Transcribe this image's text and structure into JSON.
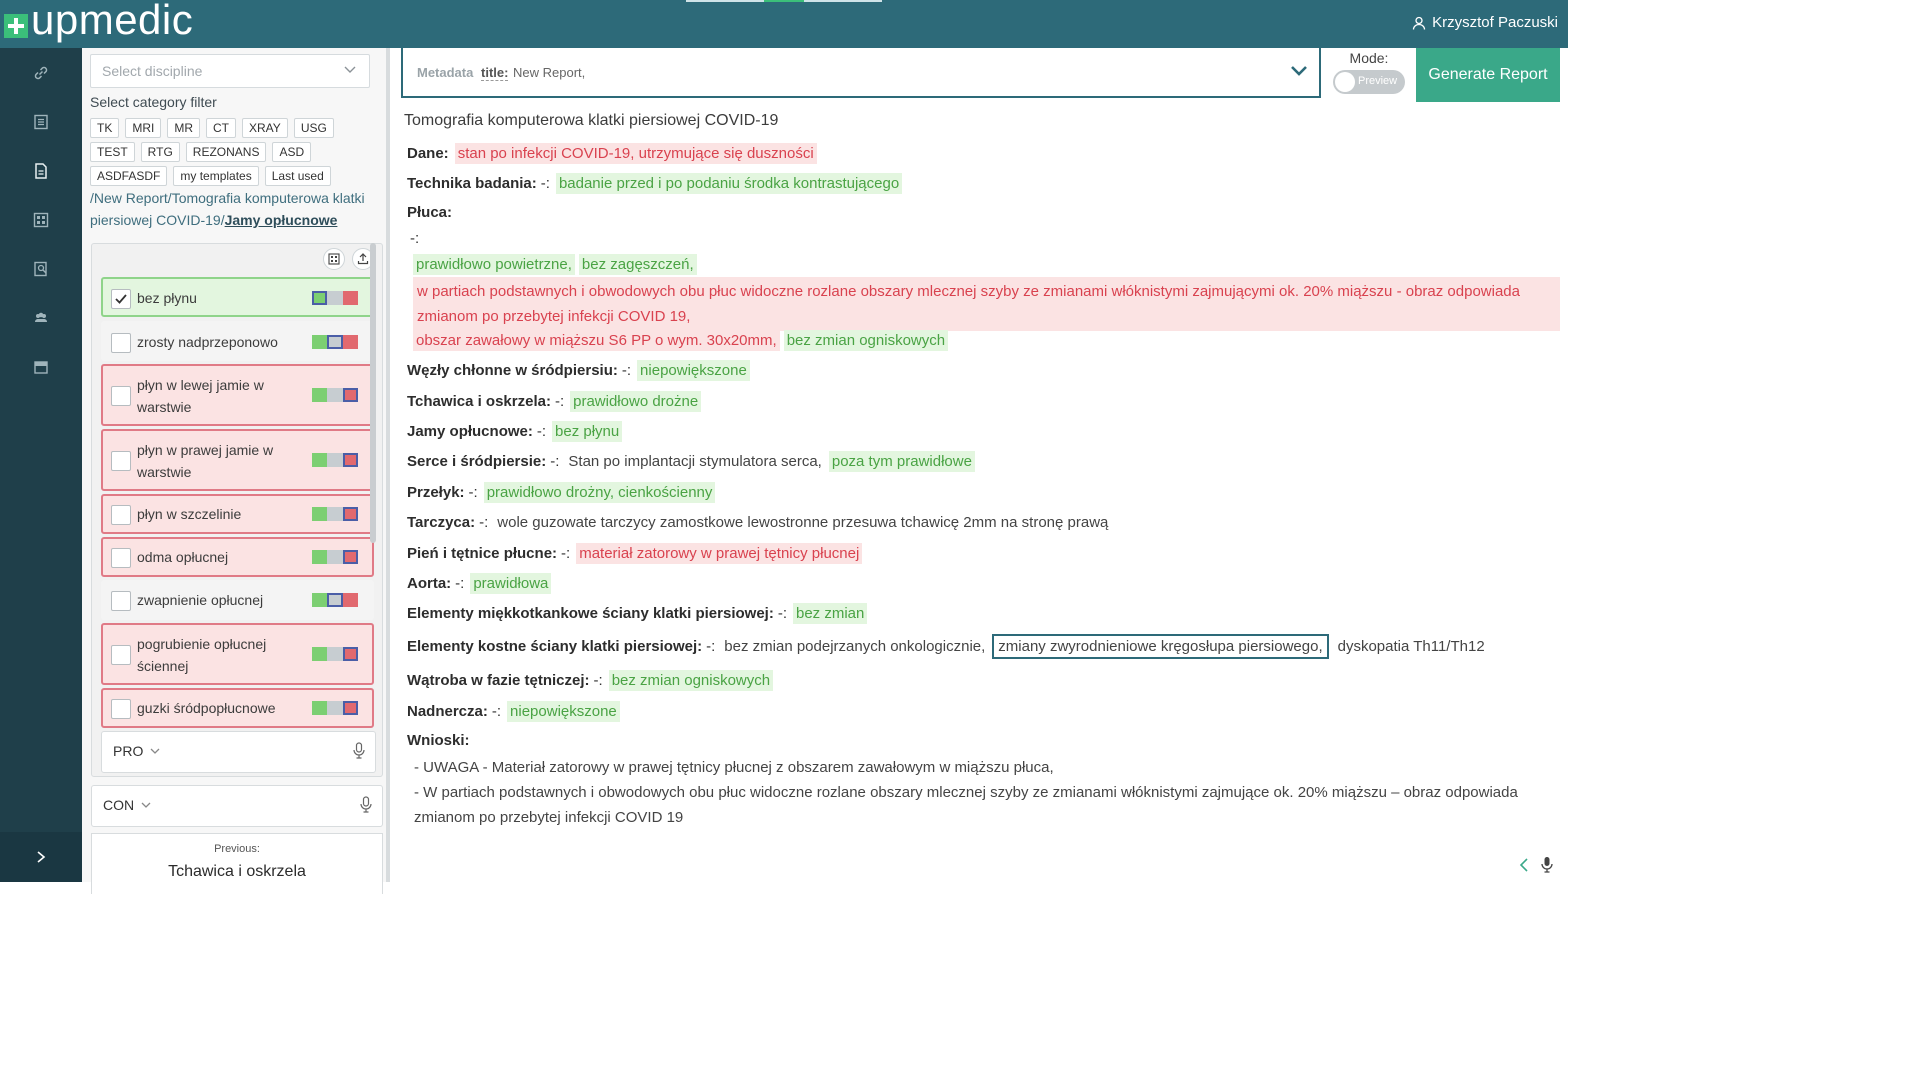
{
  "app": {
    "brand": "upmedic",
    "user_name": "Krzysztof Paczuski",
    "colors": {
      "topbar": "#2d6a79",
      "rail": "#1f3f4a",
      "accent_green": "#3aa889",
      "normal_green": "#4aa344",
      "pathology_red": "#d9424f"
    }
  },
  "rail": {
    "icons": [
      "link-icon",
      "list-icon",
      "document-icon",
      "grid-icon",
      "search-document-icon",
      "users-icon",
      "archive-icon"
    ],
    "expand_icon": "chevron-right-icon"
  },
  "left": {
    "discipline_placeholder": "Select discipline",
    "category_filter_label": "Select category filter",
    "chips": [
      "TK",
      "MRI",
      "MR",
      "CT",
      "XRAY",
      "USG",
      "TEST",
      "RTG",
      "REZONANS",
      "ASD",
      "ASDFASDF",
      "my templates",
      "Last used"
    ],
    "breadcrumb_path": "/New Report/Tomografia komputerowa klatki piersiowej COVID-19/",
    "breadcrumb_current": "Jamy opłucnowe",
    "findings": [
      {
        "label": "bez płynu",
        "checked": true,
        "state": "green"
      },
      {
        "label": "zrosty nadprzeponowo",
        "checked": false,
        "state": "plain"
      },
      {
        "label": "płyn w lewej jamie w warstwie",
        "checked": false,
        "state": "red"
      },
      {
        "label": "płyn w prawej jamie w warstwie",
        "checked": false,
        "state": "red"
      },
      {
        "label": "płyn w szczelinie",
        "checked": false,
        "state": "red"
      },
      {
        "label": "odma opłucnej",
        "checked": false,
        "state": "red"
      },
      {
        "label": "zwapnienie opłucnej",
        "checked": false,
        "state": "plain"
      },
      {
        "label": "pogrubienie opłucnej ściennej",
        "checked": false,
        "state": "red"
      },
      {
        "label": "guzki śródpopłucnowe",
        "checked": false,
        "state": "red"
      }
    ],
    "pro_label": "PRO",
    "con_label": "CON",
    "previous_label": "Previous:",
    "previous_value": "Tchawica i oskrzela"
  },
  "meta": {
    "label": "Metadata",
    "title_key": "title:",
    "title_value": "New Report,"
  },
  "mode": {
    "label": "Mode:",
    "toggle_label": "Preview",
    "enabled": false
  },
  "generate_label": "Generate Report",
  "report": {
    "title": "Tomografia komputerowa klatki piersiowej COVID-19",
    "dane_label": "Dane:",
    "dane_value": "stan po infekcji COVID-19, utrzymujące się duszności",
    "technika_label": "Technika badania:",
    "technika_value": "badanie przed i po podaniu środka kontrastującego",
    "pluca_label": "Płuca:",
    "pluca_sep": "-:",
    "pluca_1": "prawidłowo powietrzne,",
    "pluca_2": "bez zagęszczeń,",
    "pluca_3": "w partiach podstawnych i obwodowych obu płuc widoczne rozlane obszary mlecznej szyby ze zmianami włóknistymi zajmującymi ok. 20% miąższu - obraz odpowiada zmianom po przebytej infekcji COVID 19,",
    "pluca_4": "obszar zawałowy w miąższu S6 PP o wym. 30x20mm,",
    "pluca_5": "bez zmian ogniskowych",
    "wezly_label": "Węzły chłonne w śródpiersiu:",
    "wezly_value": "niepowiększone",
    "tchawica_label": "Tchawica i oskrzela:",
    "tchawica_value": "prawidłowo drożne",
    "jamy_label": "Jamy opłucnowe:",
    "jamy_value": "bez płynu",
    "serce_label": "Serce i śródpiersie:",
    "serce_value_1": "Stan po implantacji stymulatora serca,",
    "serce_value_2": "poza tym prawidłowe",
    "przelyk_label": "Przełyk:",
    "przelyk_value": "prawidłowo drożny, cienkościenny",
    "tarczyca_label": "Tarczyca:",
    "tarczyca_value": "wole guzowate tarczycy zamostkowe lewostronne przesuwa tchawicę 2mm na stronę prawą",
    "pien_label": "Pień i tętnice płucne:",
    "pien_value": "materiał zatorowy w prawej tętnicy płucnej",
    "aorta_label": "Aorta:",
    "aorta_value": "prawidłowa",
    "miekkie_label": "Elementy miękkotkankowe ściany klatki piersiowej:",
    "miekkie_value": "bez zmian",
    "kostne_label": "Elementy kostne ściany klatki piersiowej:",
    "kostne_value_1": "bez zmian podejrzanych onkologicznie,",
    "kostne_value_2": "zmiany zwyrodnieniowe kręgosłupa piersiowego,",
    "kostne_value_3": "dyskopatia Th11/Th12",
    "watroba_label": "Wątroba w fazie tętniczej:",
    "watroba_value": "bez zmian ogniskowych",
    "nadnercza_label": "Nadnercza:",
    "nadnercza_value": "niepowiększone",
    "wnioski_label": "Wnioski:",
    "wnioski_1": "- UWAGA - Materiał zatorowy w prawej tętnicy płucnej z obszarem zawałowym w miąższu płuca,",
    "wnioski_2": "- W partiach podstawnych i obwodowych obu płuc widoczne rozlane obszary mlecznej szyby ze zmianami włóknistymi zajmujące ok. 20% miąższu – obraz odpowiada zmianom po przebytej infekcji COVID 19",
    "sep": "-:"
  }
}
